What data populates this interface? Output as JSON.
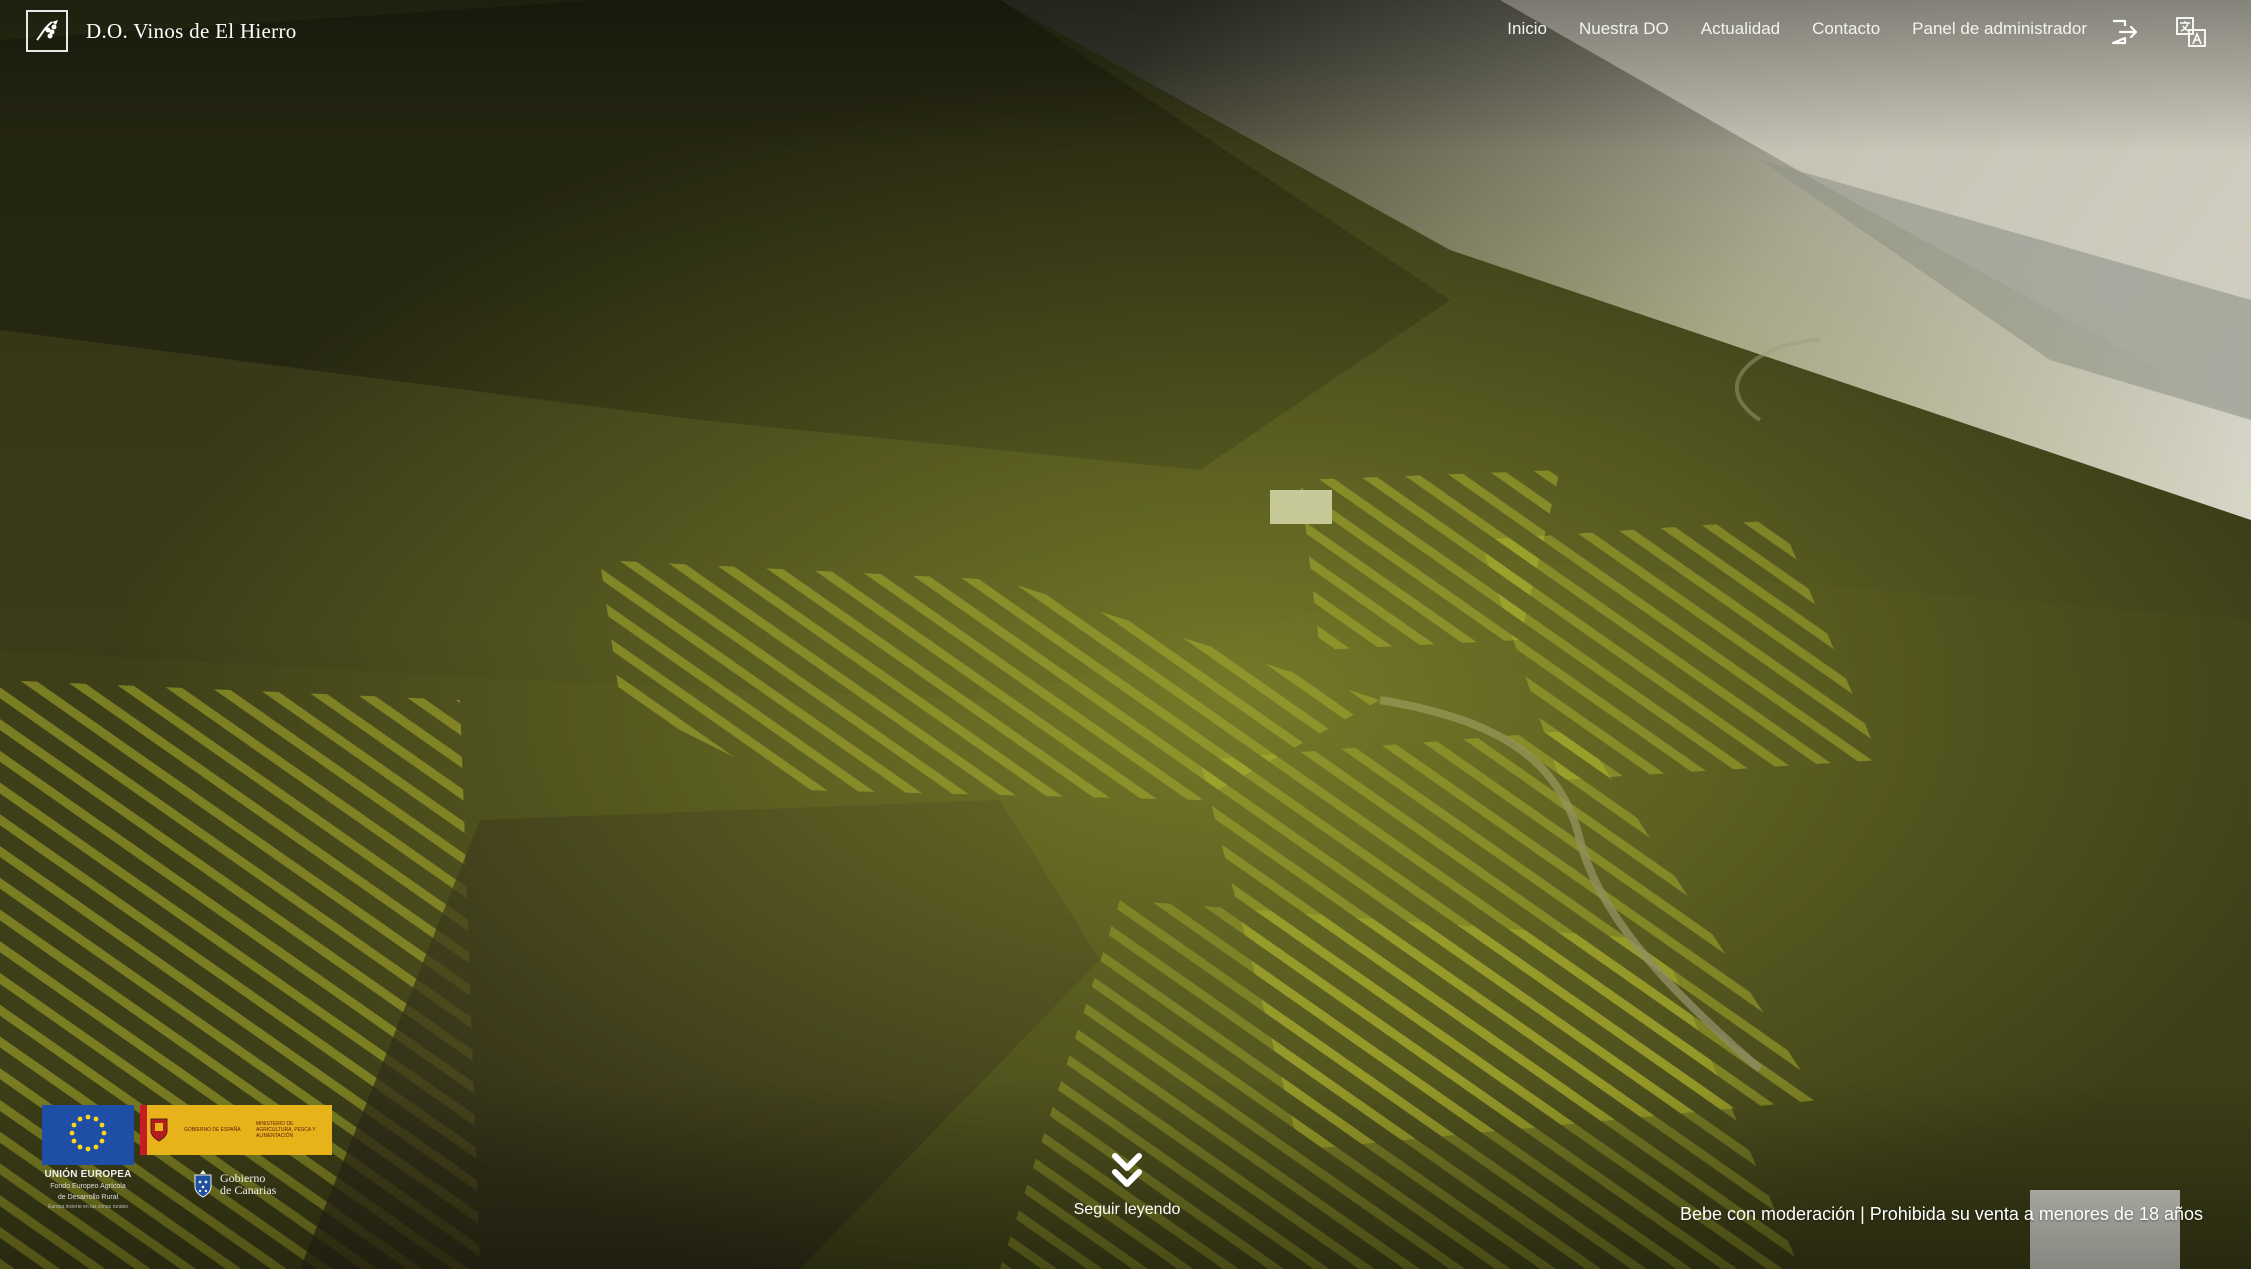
{
  "brand": {
    "name": "D.O. Vinos de El Hierro",
    "logo": "vine-logo-icon"
  },
  "nav": {
    "items": [
      {
        "label": "Inicio"
      },
      {
        "label": "Nuestra DO"
      },
      {
        "label": "Actualidad"
      },
      {
        "label": "Contacto"
      },
      {
        "label": "Panel de administrador"
      }
    ],
    "icons": [
      "logout-icon",
      "translate-icon"
    ]
  },
  "hero": {
    "description": "aerial-vineyard-background"
  },
  "logos": {
    "eu": {
      "title": "UNIÓN EUROPEA",
      "line1": "Fondo Europeo Agrícola",
      "line2": "de Desarrollo Rural",
      "line3": "Europa invierte en las zonas rurales"
    },
    "ministerio": {
      "text1": "GOBIERNO DE ESPAÑA",
      "text2": "MINISTERIO DE AGRICULTURA, PESCA Y ALIMENTACIÓN"
    },
    "canarias": {
      "line1": "Gobierno",
      "line2": "de Canarias"
    }
  },
  "continue": {
    "label": "Seguir leyendo",
    "icon": "double-chevron-down-icon"
  },
  "notice": {
    "text": "Bebe con moderación | Prohibida su venta a menores de 18 años"
  },
  "colors": {
    "vine_green": "#9ea52a",
    "eu_blue": "#1f4ea6",
    "ministerio_yellow": "#e8b21b"
  }
}
